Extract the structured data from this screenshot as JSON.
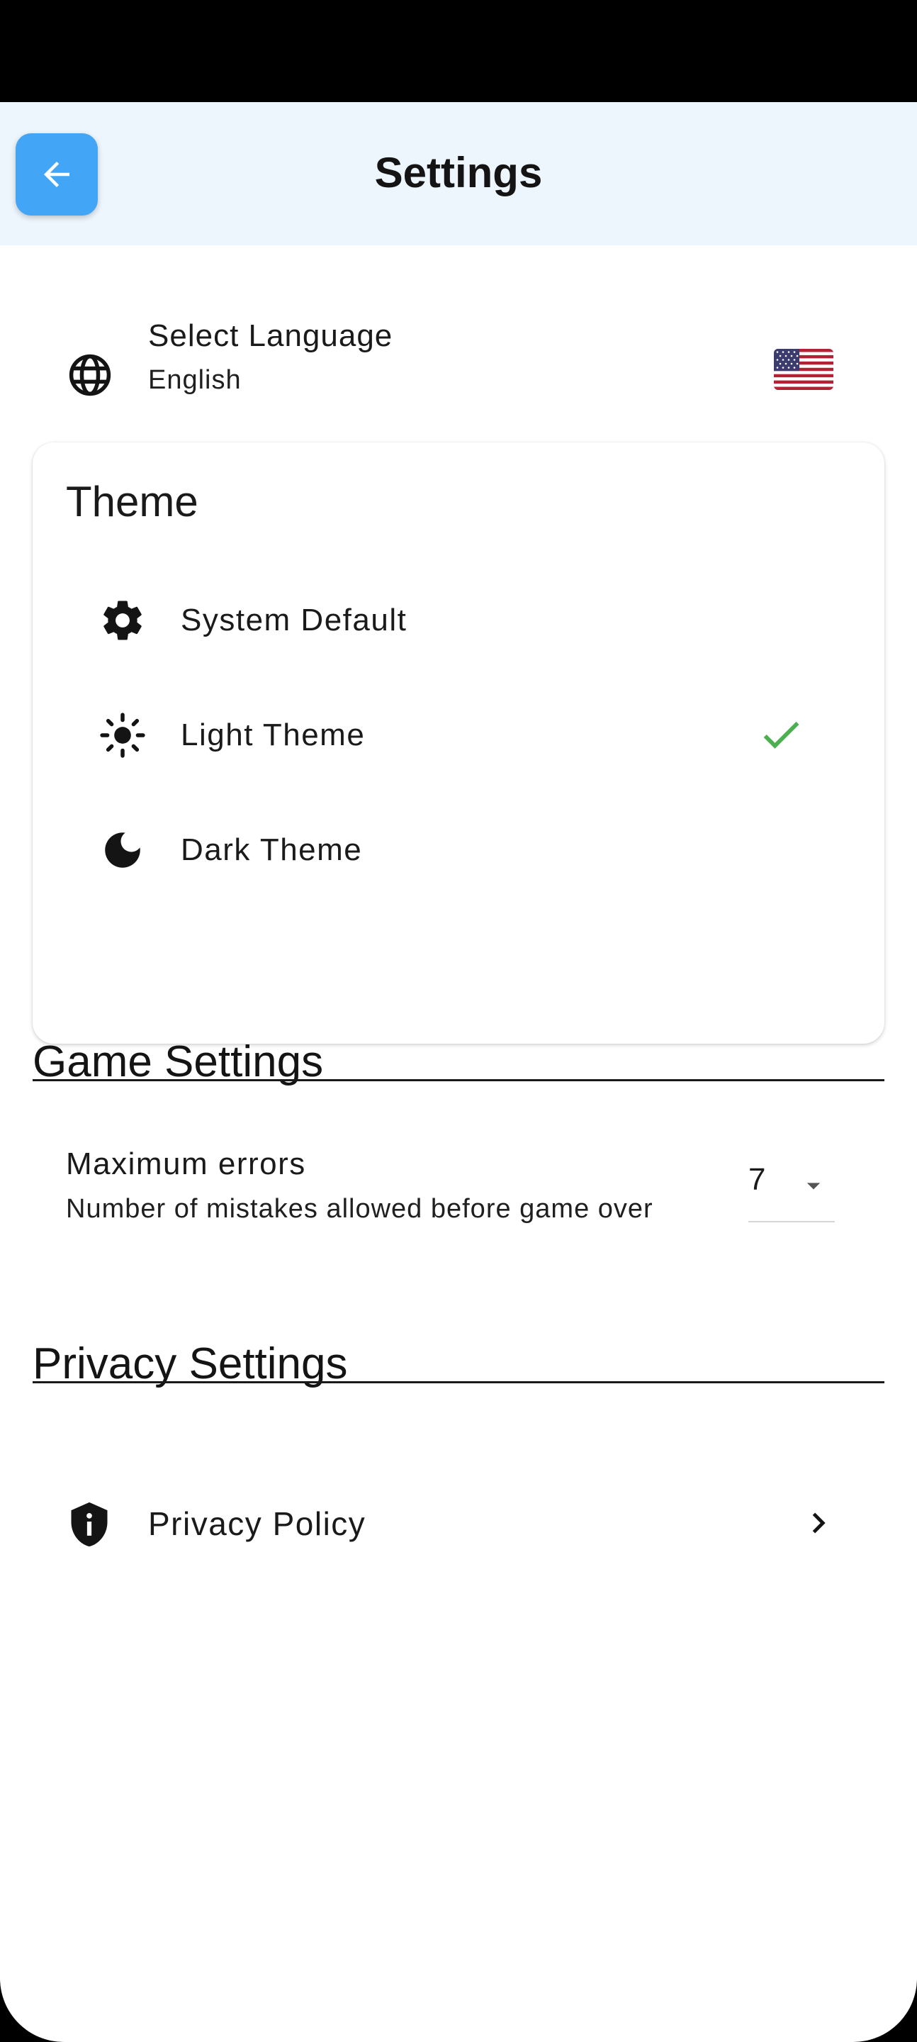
{
  "header": {
    "title": "Settings",
    "back_icon": "arrow-left-icon",
    "accent_color": "#42a5f5",
    "background_color": "#eef6fd"
  },
  "language": {
    "title": "Select Language",
    "value": "English",
    "icon": "globe-icon",
    "flag": "us-flag-icon"
  },
  "theme": {
    "title": "Theme",
    "selected": "light",
    "check_color": "#4caf50",
    "options": [
      {
        "label": "System Default",
        "icon": "gear-icon"
      },
      {
        "label": "Light Theme",
        "icon": "sun-icon"
      },
      {
        "label": "Dark Theme",
        "icon": "moon-icon"
      }
    ]
  },
  "game_settings": {
    "title": "Game Settings",
    "max_errors": {
      "title": "Maximum errors",
      "subtitle": "Number of mistakes allowed before game over",
      "value": "7"
    }
  },
  "privacy_settings": {
    "title": "Privacy Settings",
    "policy_label": "Privacy Policy",
    "icon": "shield-info-icon"
  }
}
